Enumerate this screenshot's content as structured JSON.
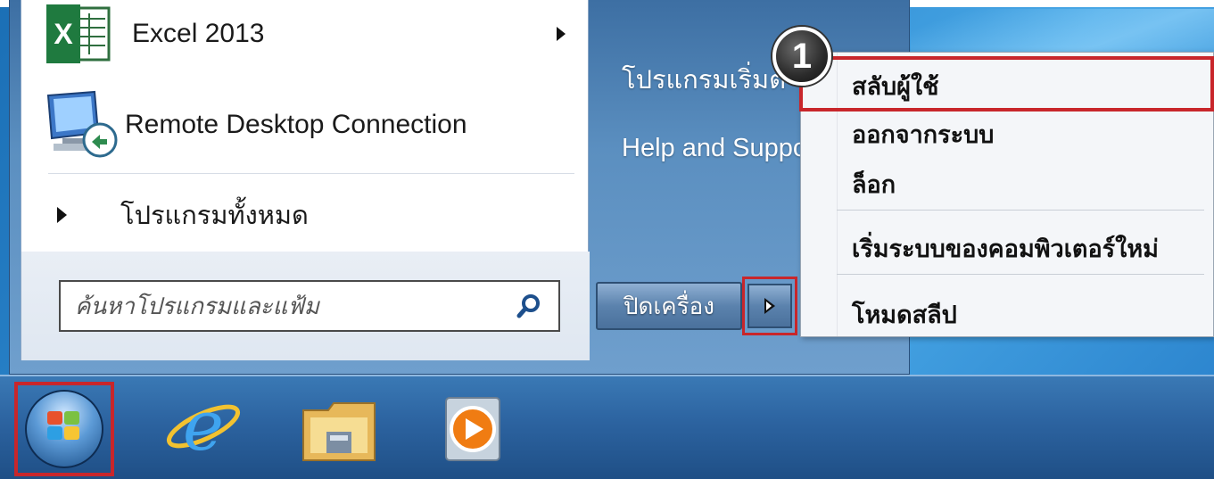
{
  "start_menu": {
    "programs": [
      {
        "label": "Excel 2013",
        "icon": "excel-icon",
        "has_submenu": true
      },
      {
        "label": "Remote Desktop Connection",
        "icon": "remote-desktop-icon",
        "has_submenu": false
      }
    ],
    "all_programs_label": "โปรแกรมทั้งหมด",
    "search_placeholder": "ค้นหาโปรแกรมและแฟ้ม",
    "right_pane": {
      "default_programs": "โปรแกรมเริ่มต้",
      "help_and_support": "Help and Suppo"
    },
    "shutdown_label": "ปิดเครื่อง"
  },
  "power_menu": {
    "items": [
      {
        "label": "สลับผู้ใช้",
        "highlighted": true
      },
      {
        "label": "ออกจากระบบ"
      },
      {
        "label": "ล็อก"
      },
      {
        "label": "เริ่มระบบของคอมพิวเตอร์ใหม่"
      },
      {
        "label": "โหมดสลีป"
      }
    ]
  },
  "annotation": {
    "step_number": "1"
  },
  "taskbar": {
    "items": [
      "start-orb",
      "internet-explorer-icon",
      "file-explorer-icon",
      "media-player-icon"
    ]
  },
  "colors": {
    "highlight_red": "#c8262b",
    "menu_blue": "#5b8fc0",
    "taskbar_blue": "#2c63a0"
  }
}
